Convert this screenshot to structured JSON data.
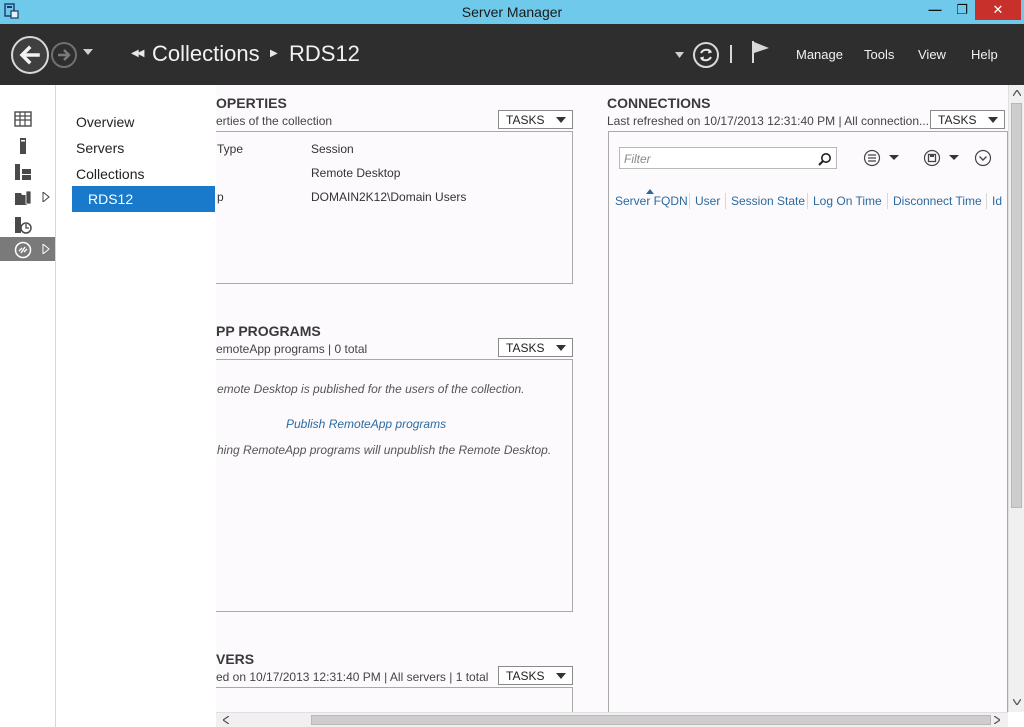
{
  "window": {
    "title": "Server Manager",
    "controls": {
      "minimize": "—",
      "maximize": "❐",
      "close": "✕"
    }
  },
  "header": {
    "breadcrumb": [
      "Collections",
      "RDS12"
    ],
    "menu": [
      "Manage",
      "Tools",
      "View",
      "Help"
    ]
  },
  "rail": {
    "icons": [
      "dashboard-icon",
      "local-server-icon",
      "all-servers-icon",
      "file-storage-icon",
      "iis-icon",
      "remote-desktop-icon"
    ],
    "active_index": 5
  },
  "sidenav": {
    "items": [
      "Overview",
      "Servers",
      "Collections"
    ],
    "selected": "RDS12"
  },
  "properties": {
    "title": "OPERTIES",
    "subtitle": "erties of the collection",
    "tasks_label": "TASKS",
    "rows": [
      {
        "label": "Type",
        "value": "Session"
      },
      {
        "label": "",
        "value": "Remote Desktop"
      },
      {
        "label": "p",
        "value": "DOMAIN2K12\\Domain Users"
      }
    ]
  },
  "remoteapp": {
    "title": "PP PROGRAMS",
    "subtitle": "emoteApp programs | 0 total",
    "tasks_label": "TASKS",
    "message1": "emote Desktop is published for the users of the collection.",
    "link": "Publish RemoteApp programs",
    "message2": "hing RemoteApp programs will unpublish the Remote Desktop."
  },
  "servers": {
    "title": "VERS",
    "subtitle": "ed on 10/17/2013 12:31:40 PM | All servers  | 1 total",
    "tasks_label": "TASKS"
  },
  "connections": {
    "title": "CONNECTIONS",
    "subtitle": "Last refreshed on 10/17/2013 12:31:40 PM | All connection...",
    "tasks_label": "TASKS",
    "filter_placeholder": "Filter",
    "columns": [
      "Server FQDN",
      "User",
      "Session State",
      "Log On Time",
      "Disconnect Time",
      "Id"
    ]
  }
}
